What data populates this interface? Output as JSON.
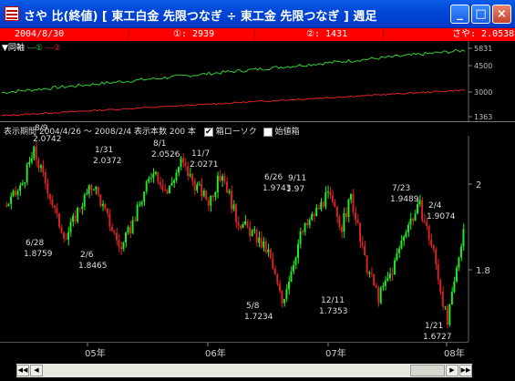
{
  "window": {
    "title": "さや 比(終値) [ 東工白金 先限つなぎ ÷ 東工金 先限つなぎ ] 週足",
    "buttons": {
      "minimize": "_",
      "maximize": "□",
      "close": "×"
    }
  },
  "info_bar": {
    "date": "2004/8/30",
    "s1": "①: 2939",
    "s2": "②: 1431",
    "ratio": "さや: 2.0538"
  },
  "upper_panel": {
    "legend": {
      "label": "同軸",
      "s1_mark": "①",
      "s2_mark": "②"
    },
    "axis_ticks": [
      "5831",
      "4500",
      "3000",
      "1363"
    ],
    "colors": {
      "s1": "#33cc33",
      "s2": "#dd2222"
    }
  },
  "lower_panel": {
    "header": {
      "period": "表示期間 2004/4/26 ～ 2008/2/4",
      "count": "表示本数 200 本",
      "check1": "箱ローソク",
      "check2": "始値箱"
    },
    "axis_ticks": [
      "2",
      "1.8"
    ],
    "x_labels": [
      "05年",
      "06年",
      "07年",
      "08年"
    ],
    "annotations": [
      {
        "date": "8/9",
        "value": "2.0742"
      },
      {
        "date": "6/28",
        "value": "1.8759"
      },
      {
        "date": "1/31",
        "value": "2.0372"
      },
      {
        "date": "8/1",
        "value": "2.0526"
      },
      {
        "date": "11/7",
        "value": "2.0271"
      },
      {
        "date": "2/6",
        "value": "1.8465"
      },
      {
        "date": "6/26",
        "value": "1.9743"
      },
      {
        "date": "9/11",
        "value": "1.97"
      },
      {
        "date": "5/8",
        "value": "1.7234"
      },
      {
        "date": "12/11",
        "value": "1.7353"
      },
      {
        "date": "7/23",
        "value": "1.9489"
      },
      {
        "date": "2/4",
        "value": "1.9074"
      },
      {
        "date": "1/21",
        "value": "1.6727"
      }
    ],
    "colors": {
      "up": "#22ee22",
      "down": "#dd2222"
    }
  },
  "scrollbar": {
    "left_end": "◀◀",
    "left": "◀",
    "right": "▶",
    "right_end": "▶▶"
  }
}
